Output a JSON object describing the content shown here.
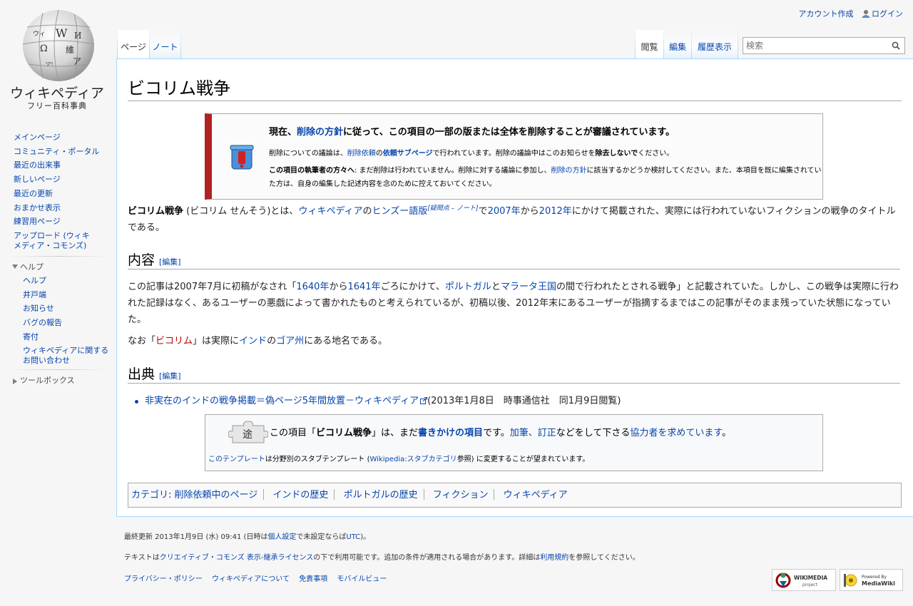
{
  "logo": {
    "wordmark": "ウィキペディア",
    "tagline": "フリー百科事典",
    "globe_glyphs": [
      "W",
      "Ω",
      "維",
      "И",
      "ア",
      "ויקי",
      "ウィ"
    ]
  },
  "sidebar": {
    "nav": [
      "メインページ",
      "コミュニティ・ポータル",
      "最近の出来事",
      "新しいページ",
      "最近の更新",
      "おまかせ表示",
      "練習用ページ",
      "アップロード (ウィキメディア・コモンズ)"
    ],
    "help_heading": "ヘルプ",
    "help_items": [
      "ヘルプ",
      "井戸端",
      "お知らせ",
      "バグの報告",
      "寄付",
      "ウィキペディアに関するお問い合わせ"
    ],
    "toolbox_heading": "ツールボックス"
  },
  "personal": {
    "create_account": "アカウント作成",
    "login": "ログイン"
  },
  "tabs": {
    "page": "ページ",
    "talk": "ノート",
    "read": "閲覧",
    "edit": "編集",
    "history": "履歴表示"
  },
  "search": {
    "placeholder": "検索"
  },
  "article": {
    "title": "ビコリム戦争",
    "notice": {
      "pre": "現在、",
      "link": "削除の方針",
      "post": "に従って、この項目の一部の版または全体を削除することが審議されています。",
      "l2_pre": "削除についての議論は、",
      "l2_link1": "削除依頼",
      "l2_mid": "の",
      "l2_link2": "依頼サブページ",
      "l2_post": "で行われています。削除の議論中はこのお知らせを",
      "l2_bold": "除去しないで",
      "l2_end": "ください。",
      "l3_bold": "この項目の執筆者の方々へ",
      "l3_a": ": まだ削除は行われていません。削除に対する議論に参加し、",
      "l3_link": "削除の方針",
      "l3_b": "に該当するかどうか検討してください。また、本項目を既に編集されていた方は、自身の編集した記述内容を念のために控えておいてください。"
    },
    "intro": {
      "bold": "ビコリム戦争",
      "a": " (ビコリム せんそう)とは、",
      "link_wp": "ウィキペディア",
      "b": "の",
      "link_hindi": "ヒンズー語版",
      "sup": "[疑問点 – ノート]",
      "c": "で",
      "link_2007": "2007年",
      "d": "から",
      "link_2012": "2012年",
      "e": "にかけて掲載された、実際には行われていないフィクションの戦争のタイトルである。"
    },
    "section1": {
      "heading": "内容",
      "edit": "[編集]",
      "p1_a": "この記事は2007年7月に初稿がなされ「",
      "p1_l1": "1640年",
      "p1_b": "から",
      "p1_l2": "1641年",
      "p1_c": "ごろにかけて、",
      "p1_l3": "ポルトガル",
      "p1_d": "と",
      "p1_l4": "マラータ王国",
      "p1_e": "の間で行われたとされる戦争」と記載されていた。しかし、この戦争は実際に行われた記録はなく、あるユーザーの悪戯によって書かれたものと考えられているが、初稿以後、2012年末にあるユーザーが指摘するまではこの記事がそのまま残っていた状態になっていた。",
      "p2_a": "なお「",
      "p2_red": "ビコリム",
      "p2_b": "」は実際に",
      "p2_l1": "インド",
      "p2_c": "の",
      "p2_l2": "ゴア州",
      "p2_d": "にある地名である。"
    },
    "section2": {
      "heading": "出典",
      "edit": "[編集]",
      "ref_link": "非実在のインドの戦争掲載＝偽ページ5年間放置－ウィキペディア",
      "ref_text": "(2013年1月8日　時事通信社　同1月9日閲覧)"
    },
    "stub": {
      "puzzle_glyph": "途",
      "a": "この項目「",
      "bold": "ビコリム戦争",
      "b": "」は、まだ",
      "l1": "書きかけの項目",
      "c": "です。",
      "l2": "加筆、訂正",
      "d": "などをして下さる",
      "l3": "協力者を求めています",
      "e": "。",
      "s2_l1": "このテンプレート",
      "s2_a": "は分野別のスタブテンプレート (",
      "s2_l2": "Wikipedia:スタブカテゴリ",
      "s2_b": "参照) に変更することが望まれています。"
    },
    "categories": {
      "label": "カテゴリ",
      "items": [
        "削除依頼中のページ",
        "インドの歴史",
        "ポルトガルの歴史",
        "フィクション",
        "ウィキペディア"
      ]
    }
  },
  "footer": {
    "lastmod_a": "最終更新 2013年1月9日 (水) 09:41 (日時は",
    "lastmod_link1": "個人設定",
    "lastmod_b": "で未設定ならば",
    "lastmod_link2": "UTC",
    "lastmod_c": ")。",
    "license_a": "テキストは",
    "license_link1": "クリエイティブ・コモンズ 表示-継承ライセンス",
    "license_b": "の下で利用可能です。追加の条件が適用される場合があります。詳細は",
    "license_link2": "利用規約",
    "license_c": "を参照してください。",
    "links": [
      "プライバシー・ポリシー",
      "ウィキペディアについて",
      "免責事項",
      "モバイルビュー"
    ],
    "badge_wikimedia": [
      "WIKIMEDIA",
      "project"
    ],
    "badge_mediawiki": [
      "Powered By",
      "MediaWiki"
    ]
  },
  "colors": {
    "link": "#0645ad",
    "redlink": "#ba0000",
    "ambox_border": "#b22222",
    "tab_border": "#a7d7f9"
  }
}
